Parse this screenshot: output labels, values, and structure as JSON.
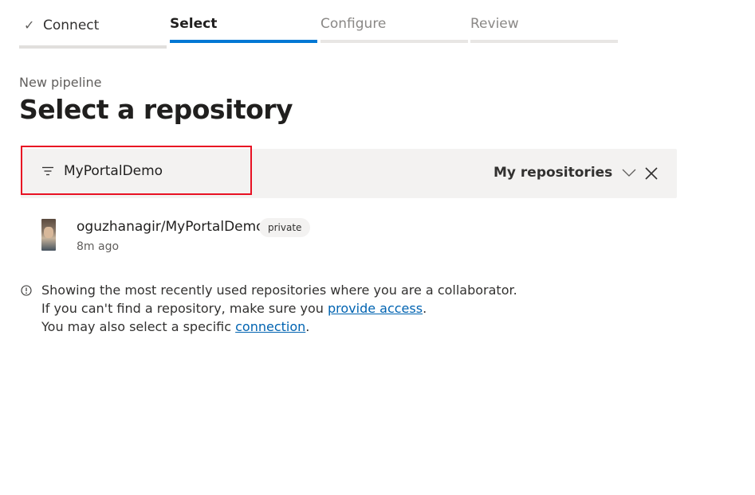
{
  "wizard": {
    "steps": [
      {
        "label": "Connect",
        "state": "completed"
      },
      {
        "label": "Select",
        "state": "active"
      },
      {
        "label": "Configure",
        "state": "pending"
      },
      {
        "label": "Review",
        "state": "pending"
      }
    ]
  },
  "header": {
    "breadcrumb": "New pipeline",
    "title": "Select a repository"
  },
  "filter": {
    "value": "MyPortalDemo",
    "scope_label": "My repositories"
  },
  "repositories": [
    {
      "name": "oguzhanagir/MyPortalDemo",
      "visibility": "private",
      "updated": "8m ago"
    }
  ],
  "info": {
    "line1": "Showing the most recently used repositories where you are a collaborator.",
    "line2_prefix": "If you can't find a repository, make sure you ",
    "line2_link": "provide access",
    "line2_suffix": ".",
    "line3_prefix": "You may also select a specific ",
    "line3_link": "connection",
    "line3_suffix": "."
  },
  "colors": {
    "accent": "#0078d4",
    "highlight_border": "#e81123",
    "link": "#0063b1"
  },
  "icons": [
    "check-icon",
    "filter-icon",
    "chevron-down-icon",
    "close-icon",
    "info-icon"
  ]
}
